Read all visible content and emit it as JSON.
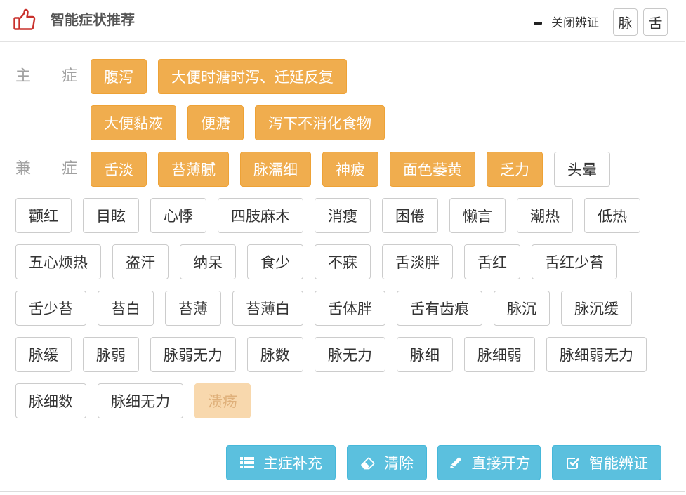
{
  "colors": {
    "selected_tag": "#f0ad4e",
    "action_button": "#5bc0de",
    "title_icon": "#c9302c"
  },
  "header": {
    "icon": "thumbs-up-icon",
    "title": "智能症状推荐",
    "close_toggle": {
      "icon": "minus-icon",
      "label": "关闭辨证"
    },
    "mode_buttons": [
      {
        "label": "脉"
      },
      {
        "label": "舌"
      }
    ]
  },
  "main_symptoms": {
    "label": "主 症",
    "rows": [
      [
        {
          "text": "腹泻",
          "state": "selected"
        },
        {
          "text": "大便时溏时泻、迁延反复",
          "state": "selected"
        }
      ],
      [
        {
          "text": "大便黏液",
          "state": "selected"
        },
        {
          "text": "便溏",
          "state": "selected"
        },
        {
          "text": "泻下不消化食物",
          "state": "selected"
        }
      ]
    ]
  },
  "secondary_symptoms": {
    "label": "兼 症",
    "tags": [
      {
        "text": "舌淡",
        "state": "selected"
      },
      {
        "text": "苔薄腻",
        "state": "selected"
      },
      {
        "text": "脉濡细",
        "state": "selected"
      },
      {
        "text": "神疲",
        "state": "selected"
      },
      {
        "text": "面色萎黄",
        "state": "selected"
      },
      {
        "text": "乏力",
        "state": "selected"
      },
      {
        "text": "头晕",
        "state": "default"
      },
      {
        "text": "颧红",
        "state": "default"
      },
      {
        "text": "目眩",
        "state": "default"
      },
      {
        "text": "心悸",
        "state": "default"
      },
      {
        "text": "四肢麻木",
        "state": "default"
      },
      {
        "text": "消瘦",
        "state": "default"
      },
      {
        "text": "困倦",
        "state": "default"
      },
      {
        "text": "懒言",
        "state": "default"
      },
      {
        "text": "潮热",
        "state": "default"
      },
      {
        "text": "低热",
        "state": "default"
      },
      {
        "text": "五心烦热",
        "state": "default"
      },
      {
        "text": "盗汗",
        "state": "default"
      },
      {
        "text": "纳呆",
        "state": "default"
      },
      {
        "text": "食少",
        "state": "default"
      },
      {
        "text": "不寐",
        "state": "default"
      },
      {
        "text": "舌淡胖",
        "state": "default"
      },
      {
        "text": "舌红",
        "state": "default"
      },
      {
        "text": "舌红少苔",
        "state": "default"
      },
      {
        "text": "舌少苔",
        "state": "default"
      },
      {
        "text": "苔白",
        "state": "default"
      },
      {
        "text": "苔薄",
        "state": "default"
      },
      {
        "text": "苔薄白",
        "state": "default"
      },
      {
        "text": "舌体胖",
        "state": "default"
      },
      {
        "text": "舌有齿痕",
        "state": "default"
      },
      {
        "text": "脉沉",
        "state": "default"
      },
      {
        "text": "脉沉缓",
        "state": "default"
      },
      {
        "text": "脉缓",
        "state": "default"
      },
      {
        "text": "脉弱",
        "state": "default"
      },
      {
        "text": "脉弱无力",
        "state": "default"
      },
      {
        "text": "脉数",
        "state": "default"
      },
      {
        "text": "脉无力",
        "state": "default"
      },
      {
        "text": "脉细",
        "state": "default"
      },
      {
        "text": "脉细弱",
        "state": "default"
      },
      {
        "text": "脉细弱无力",
        "state": "default"
      },
      {
        "text": "脉细数",
        "state": "default"
      },
      {
        "text": "脉细无力",
        "state": "default"
      },
      {
        "text": "溃疡",
        "state": "disabled"
      }
    ]
  },
  "actions": [
    {
      "icon": "list-icon",
      "label": "主症补充"
    },
    {
      "icon": "eraser-icon",
      "label": "清除"
    },
    {
      "icon": "pencil-icon",
      "label": "直接开方"
    },
    {
      "icon": "check-square-icon",
      "label": "智能辨证"
    }
  ]
}
